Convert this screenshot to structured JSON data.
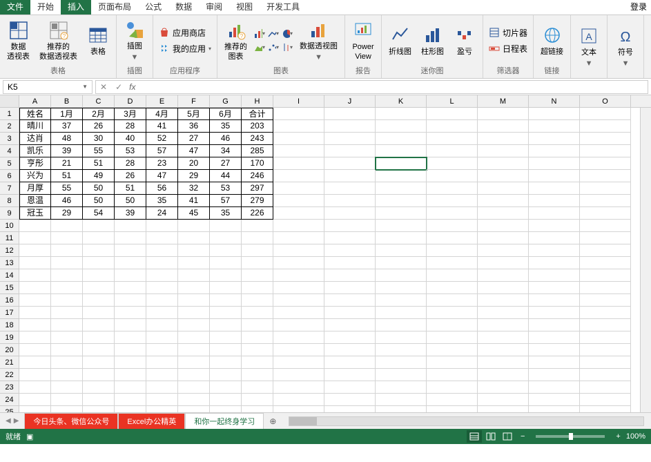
{
  "title_tabs": {
    "file": "文件",
    "items": [
      "开始",
      "插入",
      "页面布局",
      "公式",
      "数据",
      "审阅",
      "视图",
      "开发工具"
    ],
    "active_index": 1,
    "login": "登录"
  },
  "ribbon": {
    "groups": {
      "tables": {
        "label": "表格",
        "pivot": "数据\n透视表",
        "recommend_pivot": "推荐的\n数据透视表",
        "table": "表格"
      },
      "illustrations": {
        "label": "插图",
        "pictures": "插图"
      },
      "apps": {
        "label": "应用程序",
        "store": "应用商店",
        "myapps": "我的应用"
      },
      "charts": {
        "label": "图表",
        "recommend": "推荐的\n图表",
        "pivotchart": "数据透视图"
      },
      "reports": {
        "label": "报告",
        "powerview": "Power\nView"
      },
      "sparklines": {
        "label": "迷你图",
        "line": "折线图",
        "column": "柱形图",
        "winloss": "盈亏"
      },
      "filters": {
        "label": "筛选器",
        "slicer": "切片器",
        "timeline": "日程表"
      },
      "links": {
        "label": "链接",
        "hyperlink": "超链接"
      },
      "text": {
        "label": "文本",
        "btn": "文本"
      },
      "symbols": {
        "label": "符号",
        "btn": "符号"
      }
    }
  },
  "namebox": "K5",
  "formula": "",
  "columns": [
    "A",
    "B",
    "C",
    "D",
    "E",
    "F",
    "G",
    "H",
    "I",
    "J",
    "K",
    "L",
    "M",
    "N",
    "O"
  ],
  "row_count": 25,
  "selected_cell": {
    "row": 5,
    "col": "K"
  },
  "chart_data": {
    "type": "table",
    "headers": [
      "姓名",
      "1月",
      "2月",
      "3月",
      "4月",
      "5月",
      "6月",
      "合计"
    ],
    "rows": [
      [
        "晴川",
        37,
        26,
        28,
        41,
        36,
        35,
        203
      ],
      [
        "达肖",
        48,
        30,
        40,
        52,
        27,
        46,
        243
      ],
      [
        "凯乐",
        39,
        55,
        53,
        57,
        47,
        34,
        285
      ],
      [
        "亨彤",
        21,
        51,
        28,
        23,
        20,
        27,
        170
      ],
      [
        "兴为",
        51,
        49,
        26,
        47,
        29,
        44,
        246
      ],
      [
        "月厚",
        55,
        50,
        51,
        56,
        32,
        53,
        297
      ],
      [
        "恩温",
        46,
        50,
        50,
        35,
        41,
        57,
        279
      ],
      [
        "冠玉",
        29,
        54,
        39,
        24,
        45,
        35,
        226
      ]
    ]
  },
  "sheet_tabs": [
    {
      "label": "今日头条、微信公众号",
      "style": "red"
    },
    {
      "label": "Excel办公精英",
      "style": "red"
    },
    {
      "label": "和你一起终身学习",
      "style": "green"
    }
  ],
  "sheet_add": "⊕",
  "status": {
    "ready": "就绪",
    "zoom": "100%",
    "zoom_minus": "−",
    "zoom_plus": "+"
  }
}
